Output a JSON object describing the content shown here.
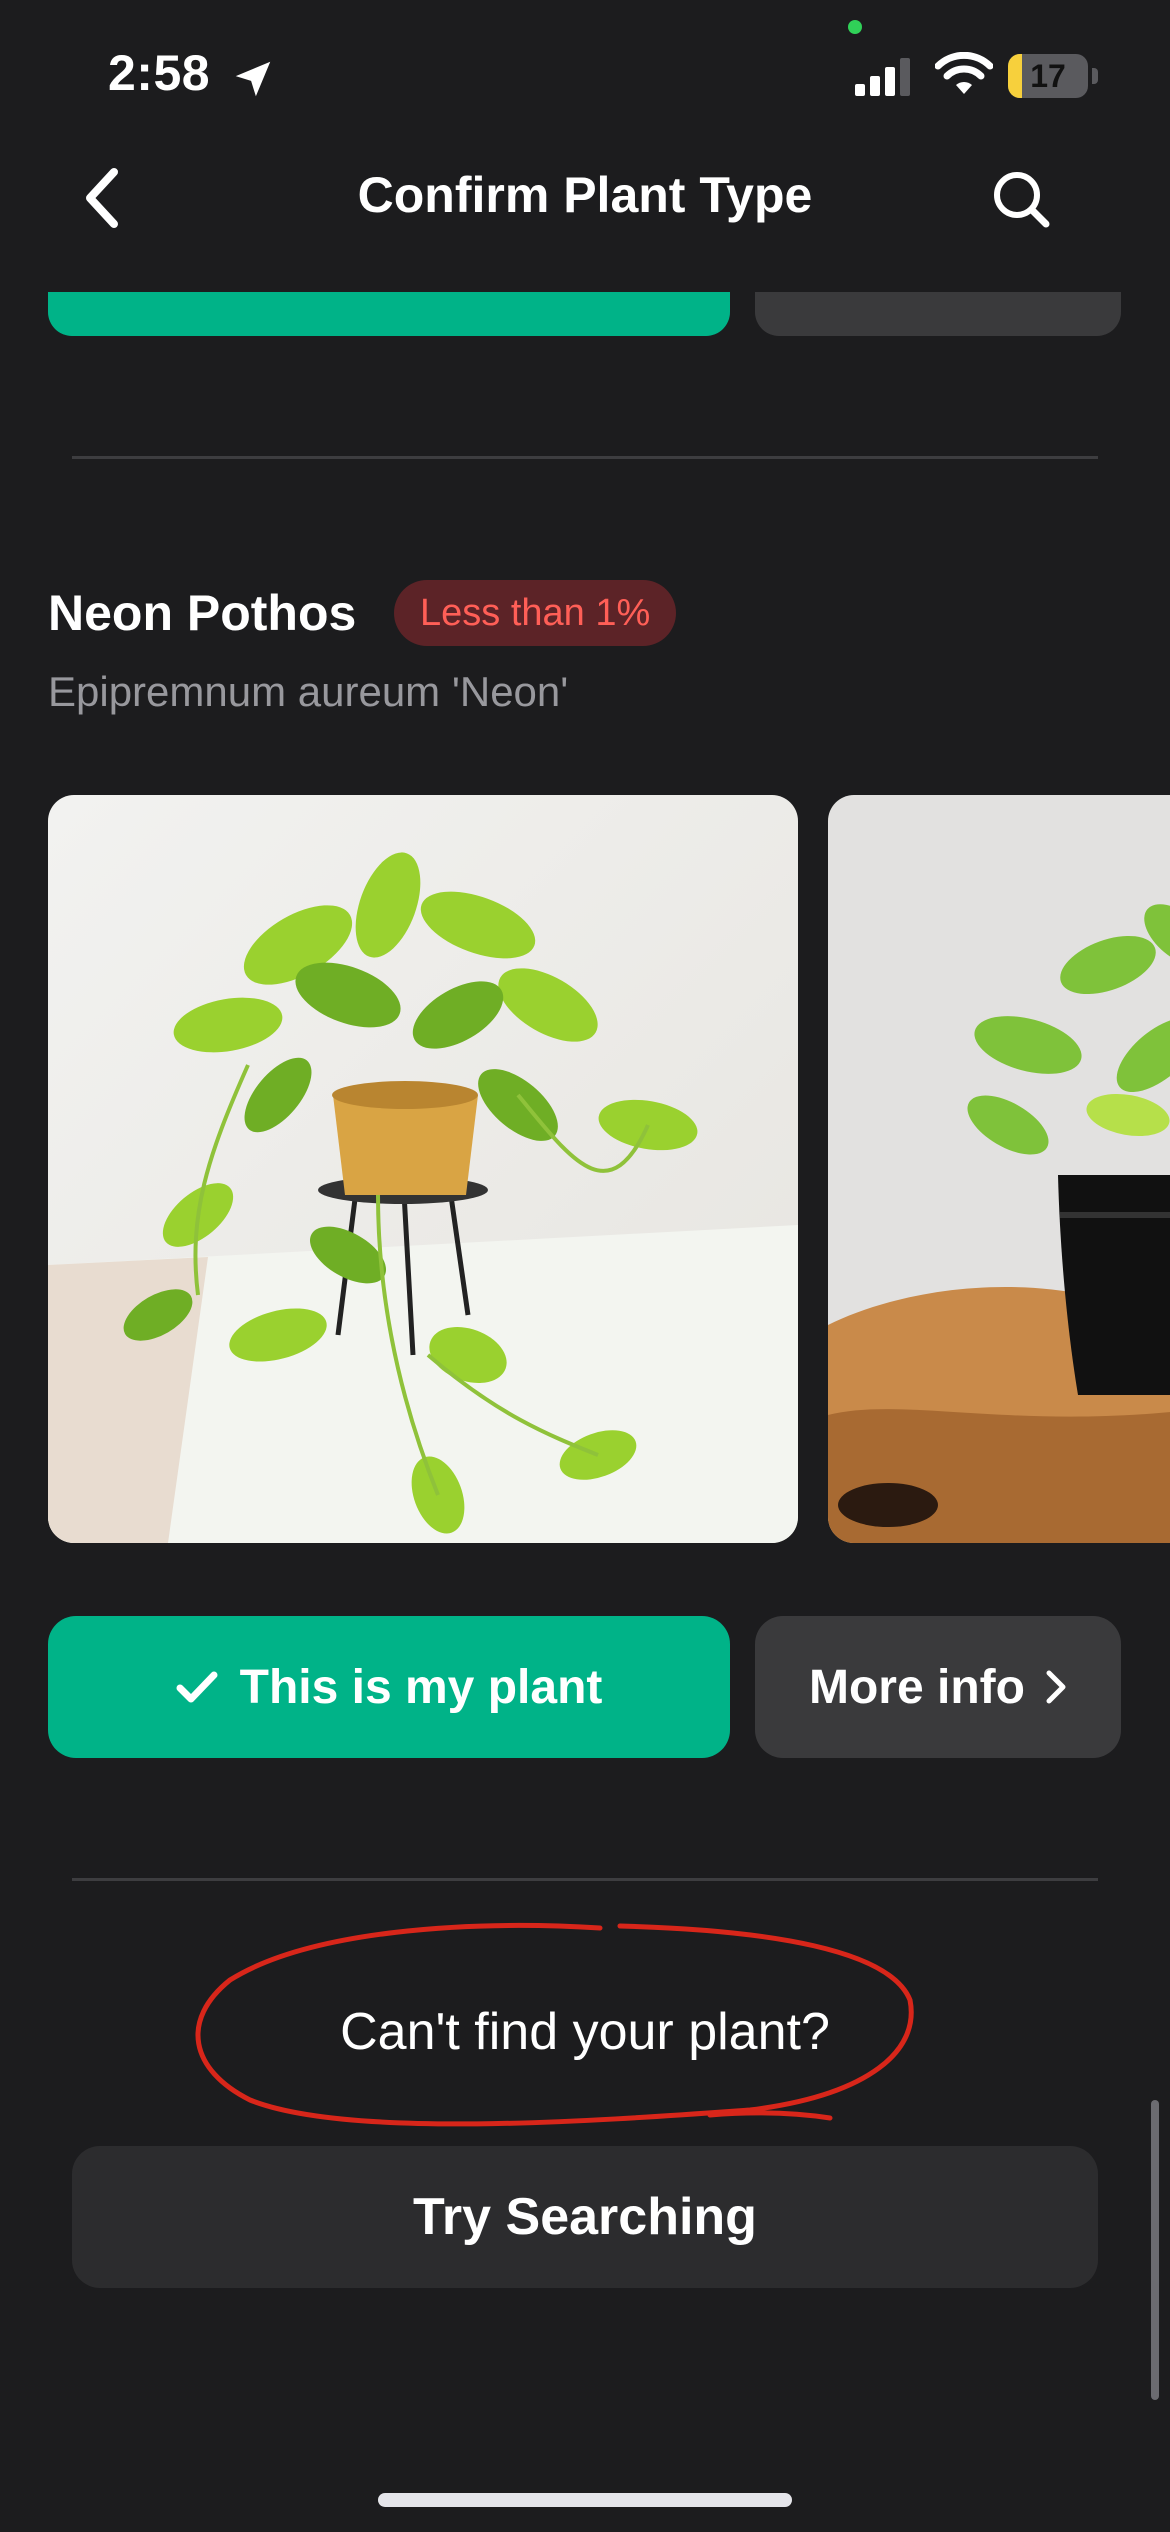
{
  "status_bar": {
    "time": "2:58",
    "battery_level": "17",
    "battery_fraction": 0.17
  },
  "nav": {
    "title": "Confirm Plant Type"
  },
  "plant": {
    "common_name": "Neon Pothos",
    "confidence": "Less than 1%",
    "scientific_name": "Epipremnum aureum 'Neon'"
  },
  "actions": {
    "confirm_label": "This is my plant",
    "more_info_label": "More info"
  },
  "footer": {
    "prompt": "Can't find your plant?",
    "search_label": "Try Searching"
  },
  "colors": {
    "accent": "#00b388",
    "background": "#1c1c1e",
    "badge_bg": "#5c2327",
    "badge_text": "#ff5f57",
    "annotation": "#d8261a"
  },
  "icons": [
    "location-arrow-icon",
    "signal-icon",
    "wifi-icon",
    "battery-icon",
    "back-chevron-icon",
    "search-icon",
    "checkmark-icon",
    "chevron-right-icon"
  ]
}
